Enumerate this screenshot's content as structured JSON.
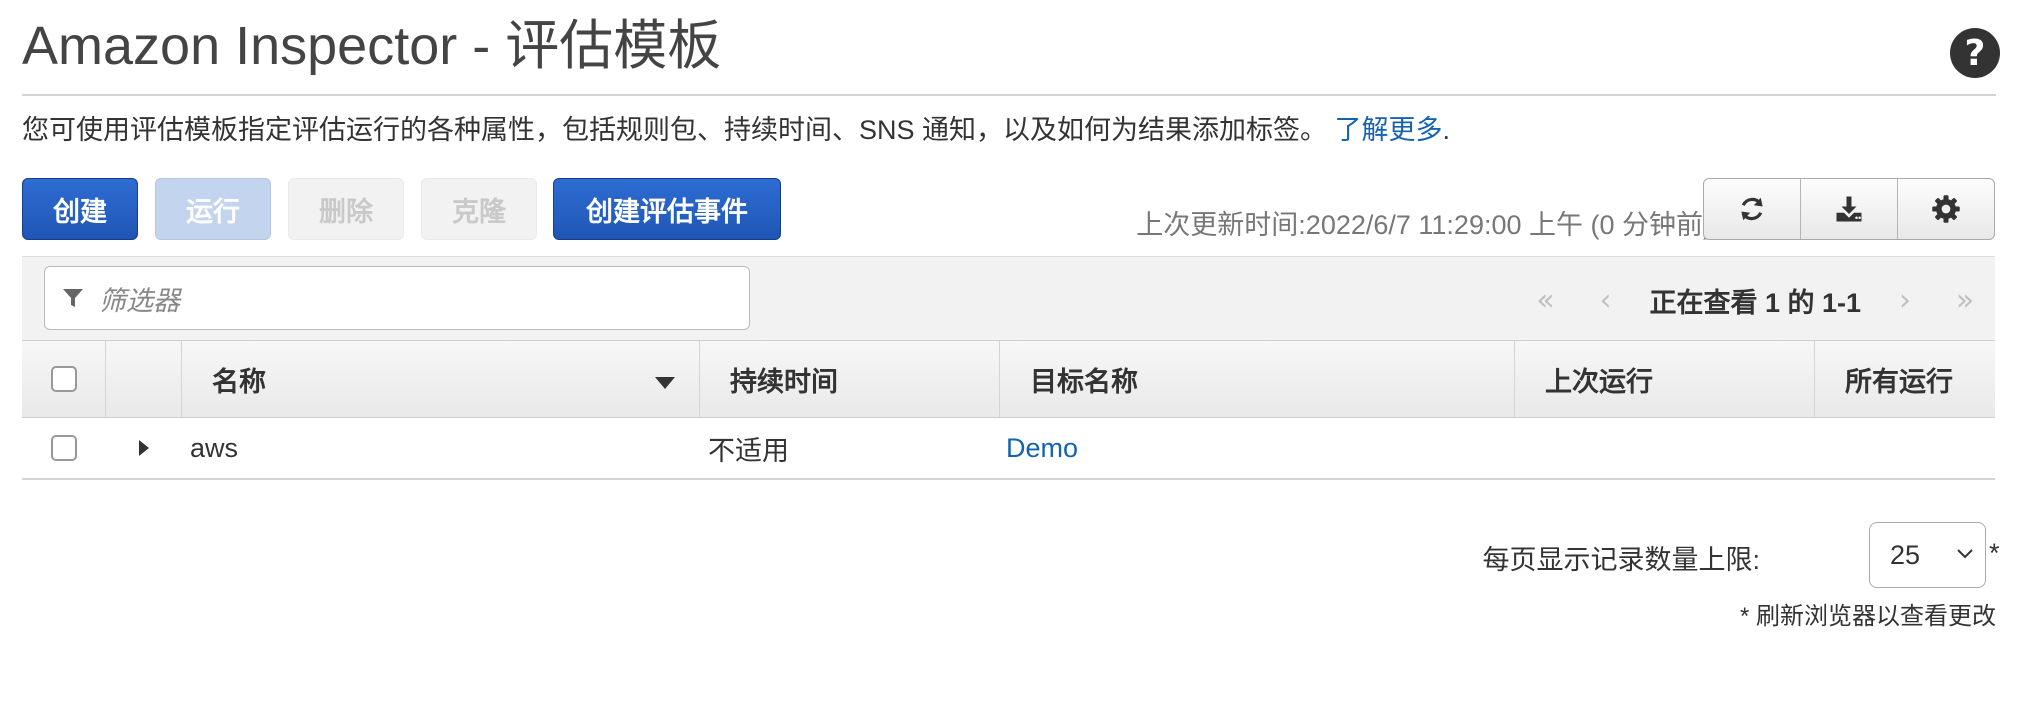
{
  "header": {
    "title": "Amazon Inspector - 评估模板",
    "description": "您可使用评估模板指定评估运行的各种属性，包括规则包、持续时间、SNS 通知，以及如何为结果添加标签。",
    "learn_more": "了解更多",
    "learn_more_suffix": "."
  },
  "toolbar": {
    "create": "创建",
    "run": "运行",
    "delete": "删除",
    "clone": "克隆",
    "create_event": "创建评估事件",
    "last_updated": "上次更新时间:2022/6/7 11:29:00 上午 (0 分钟前)",
    "icons": [
      "refresh-icon",
      "download-icon",
      "gear-icon"
    ]
  },
  "filter": {
    "placeholder": "筛选器"
  },
  "pagination": {
    "first": "«",
    "prev": "‹",
    "status": "正在查看 1 的 1-1",
    "next": "›",
    "last": "»"
  },
  "table": {
    "columns": [
      "名称",
      "持续时间",
      "目标名称",
      "上次运行",
      "所有运行"
    ],
    "rows": [
      {
        "name": "aws",
        "duration": "不适用",
        "target": "Demo",
        "last_run": "",
        "all_runs": ""
      }
    ]
  },
  "footer": {
    "per_page_label": "每页显示记录数量上限:",
    "per_page_value": "25",
    "asterisk": "*",
    "note": "* 刷新浏览器以查看更改"
  },
  "colors": {
    "primary": "#1f56b4",
    "link": "#1463b3"
  }
}
